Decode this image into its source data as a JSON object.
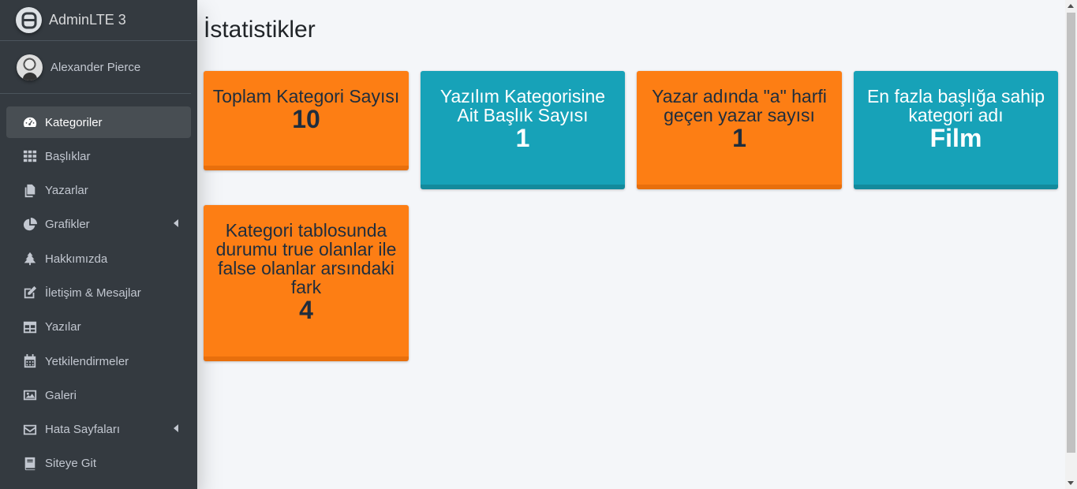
{
  "brand": {
    "name": "AdminLTE 3"
  },
  "user": {
    "name": "Alexander Pierce"
  },
  "sidebar": {
    "items": [
      {
        "label": "Kategoriler",
        "icon": "tachometer-icon",
        "active": true
      },
      {
        "label": "Başlıklar",
        "icon": "grid-icon"
      },
      {
        "label": "Yazarlar",
        "icon": "copy-icon"
      },
      {
        "label": "Grafikler",
        "icon": "pie-chart-icon",
        "has_arrow": true
      },
      {
        "label": "Hakkımızda",
        "icon": "tree-icon"
      },
      {
        "label": "İletişim & Mesajlar",
        "icon": "edit-icon"
      },
      {
        "label": "Yazılar",
        "icon": "table-icon"
      },
      {
        "label": "Yetkilendirmeler",
        "icon": "calendar-icon"
      },
      {
        "label": "Galeri",
        "icon": "image-icon"
      },
      {
        "label": "Hata Sayfaları",
        "icon": "envelope-icon",
        "has_arrow": true
      },
      {
        "label": "Siteye Git",
        "icon": "book-icon"
      }
    ]
  },
  "main": {
    "title": "İstatistikler",
    "stats": [
      {
        "label": "Toplam Kategori Sayısı",
        "value": "10",
        "color": "#fd7e14"
      },
      {
        "label": "Yazılım Kategorisine Ait Başlık Sayısı",
        "value": "1",
        "color": "#17a2b8"
      },
      {
        "label": "Yazar adında \"a\" harfi geçen yazar sayısı",
        "value": "1",
        "color": "#fd7e14"
      },
      {
        "label": "En fazla başlığa sahip kategori adı",
        "value": "Film",
        "color": "#17a2b8"
      },
      {
        "label": "Kategori tablosunda durumu true olanlar ile false olanlar arsındaki fark",
        "value": "4",
        "color": "#fd7e14"
      }
    ]
  }
}
